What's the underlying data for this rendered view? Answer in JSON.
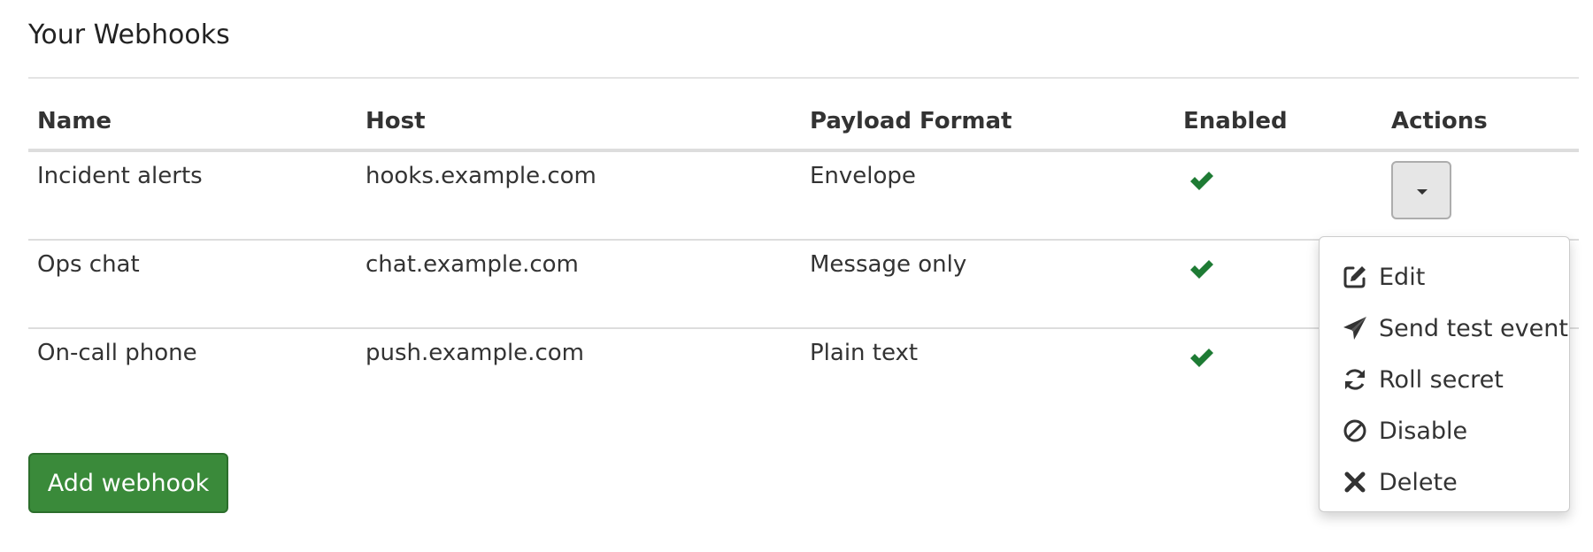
{
  "page": {
    "title": "Your Webhooks"
  },
  "table": {
    "columns": [
      "Name",
      "Host",
      "Payload Format",
      "Enabled",
      "Actions"
    ],
    "rows": [
      {
        "name": "Incident alerts",
        "host": "hooks.example.com",
        "format": "Envelope",
        "enabled": true
      },
      {
        "name": "Ops chat",
        "host": "chat.example.com",
        "format": "Message only",
        "enabled": true
      },
      {
        "name": "On-call phone",
        "host": "push.example.com",
        "format": "Plain text",
        "enabled": true
      }
    ]
  },
  "actions_menu": {
    "open_for_row": 0,
    "items": [
      {
        "label": "Edit",
        "icon": "edit-icon"
      },
      {
        "label": "Send test event",
        "icon": "paper-plane-icon"
      },
      {
        "label": "Roll secret",
        "icon": "refresh-icon"
      },
      {
        "label": "Disable",
        "icon": "ban-icon"
      },
      {
        "label": "Delete",
        "icon": "close-icon"
      }
    ]
  },
  "footer": {
    "add_button_label": "Add webhook"
  },
  "colors": {
    "check": "#1e7b34",
    "primary_button": "#3a8a3a",
    "border": "#dddddd"
  }
}
